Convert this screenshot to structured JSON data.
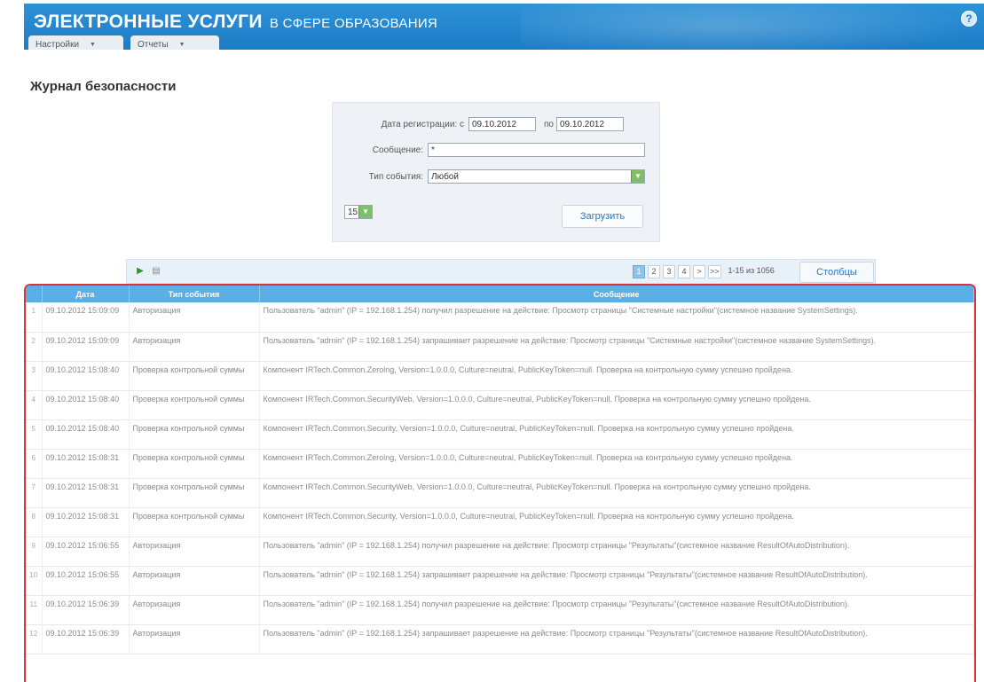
{
  "header": {
    "title_main": "ЭЛЕКТРОННЫЕ УСЛУГИ",
    "title_sub": "В СФЕРЕ ОБРАЗОВАНИЯ",
    "menus": [
      "Настройки",
      "Отчеты"
    ],
    "help": "?"
  },
  "page_title": "Журнал безопасности",
  "filter": {
    "date_label": "Дата регистрации: с",
    "date_from": "09.10.2012",
    "date_to_label": "по",
    "date_to": "09.10.2012",
    "message_label": "Сообщение:",
    "message_value": "*",
    "event_type_label": "Тип события:",
    "event_type_value": "Любой",
    "page_size": "15",
    "load_button": "Загрузить"
  },
  "toolbar": {
    "pages": [
      "1",
      "2",
      "3",
      "4",
      ">",
      ">>"
    ],
    "current_page": "1",
    "range": "1-15 из 1056",
    "columns_button": "Столбцы"
  },
  "grid": {
    "columns": [
      "Дата",
      "Тип события",
      "Сообщение"
    ],
    "rows": [
      {
        "n": "1",
        "date": "09.10.2012 15:09:09",
        "type": "Авторизация",
        "msg": "Пользователь \"admin\" (IP = 192.168.1.254) получил разрешение на действие: Просмотр страницы \"Системные настройки\"(системное название SystemSettings)."
      },
      {
        "n": "2",
        "date": "09.10.2012 15:09:09",
        "type": "Авторизация",
        "msg": "Пользователь \"admin\" (IP = 192.168.1.254) запрашивает разрешение на действие: Просмотр страницы \"Системные настройки\"(системное название SystemSettings)."
      },
      {
        "n": "3",
        "date": "09.10.2012 15:08:40",
        "type": "Проверка контрольной суммы",
        "msg": "Компонент IRTech.Common.Zerolng, Version=1.0.0.0, Culture=neutral, PublicKeyToken=null. Проверка на контрольную сумму успешно пройдена."
      },
      {
        "n": "4",
        "date": "09.10.2012 15:08:40",
        "type": "Проверка контрольной суммы",
        "msg": "Компонент IRTech.Common.SecurityWeb, Version=1.0.0.0, Culture=neutral, PublicKeyToken=null. Проверка на контрольную сумму успешно пройдена."
      },
      {
        "n": "5",
        "date": "09.10.2012 15:08:40",
        "type": "Проверка контрольной суммы",
        "msg": "Компонент IRTech.Common.Security, Version=1.0.0.0, Culture=neutral, PublicKeyToken=null. Проверка на контрольную сумму успешно пройдена."
      },
      {
        "n": "6",
        "date": "09.10.2012 15:08:31",
        "type": "Проверка контрольной суммы",
        "msg": "Компонент IRTech.Common.Zerolng, Version=1.0.0.0, Culture=neutral, PublicKeyToken=null. Проверка на контрольную сумму успешно пройдена."
      },
      {
        "n": "7",
        "date": "09.10.2012 15:08:31",
        "type": "Проверка контрольной суммы",
        "msg": "Компонент IRTech.Common.SecurityWeb, Version=1.0.0.0, Culture=neutral, PublicKeyToken=null. Проверка на контрольную сумму успешно пройдена."
      },
      {
        "n": "8",
        "date": "09.10.2012 15:08:31",
        "type": "Проверка контрольной суммы",
        "msg": "Компонент IRTech.Common.Security, Version=1.0.0.0, Culture=neutral, PublicKeyToken=null. Проверка на контрольную сумму успешно пройдена."
      },
      {
        "n": "9",
        "date": "09.10.2012 15:06:55",
        "type": "Авторизация",
        "msg": "Пользователь \"admin\" (IP = 192.168.1.254) получил разрешение на действие: Просмотр страницы \"Результаты\"(системное название ResultOfAutoDistribution)."
      },
      {
        "n": "10",
        "date": "09.10.2012 15:06:55",
        "type": "Авторизация",
        "msg": "Пользователь \"admin\" (IP = 192.168.1.254) запрашивает разрешение на действие: Просмотр страницы \"Результаты\"(системное название ResultOfAutoDistribution)."
      },
      {
        "n": "11",
        "date": "09.10.2012 15:06:39",
        "type": "Авторизация",
        "msg": "Пользователь \"admin\" (IP = 192.168.1.254) получил разрешение на действие: Просмотр страницы \"Результаты\"(системное название ResultOfAutoDistribution)."
      },
      {
        "n": "12",
        "date": "09.10.2012 15:06:39",
        "type": "Авторизация",
        "msg": "Пользователь \"admin\" (IP = 192.168.1.254) запрашивает разрешение на действие: Просмотр страницы \"Результаты\"(системное название ResultOfAutoDistribution)."
      }
    ]
  }
}
